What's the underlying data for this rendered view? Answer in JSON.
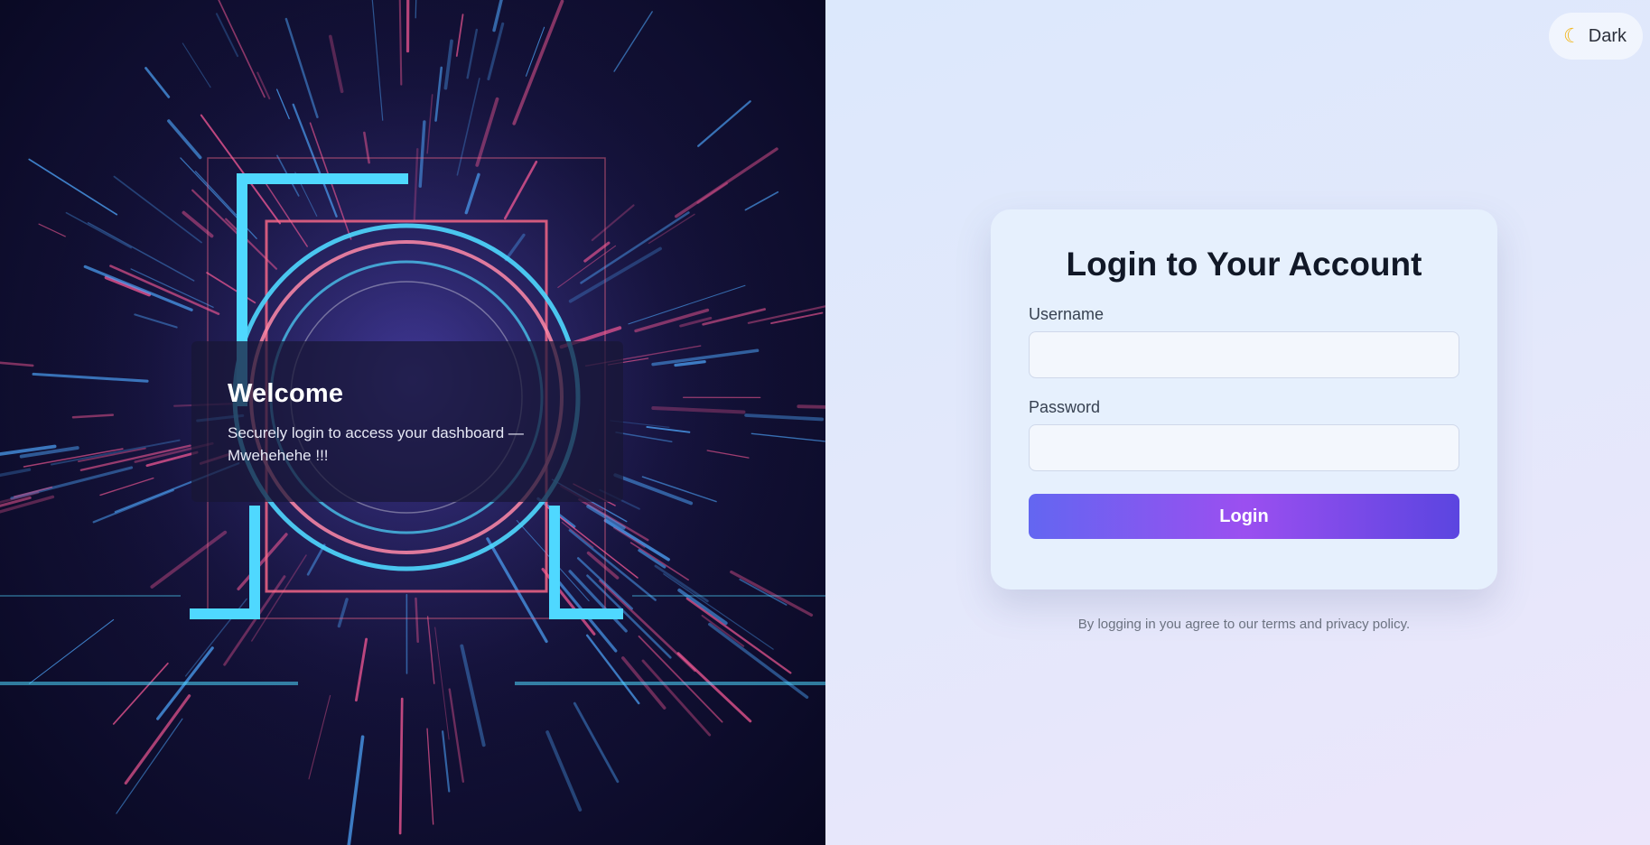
{
  "hero": {
    "welcome_title": "Welcome",
    "welcome_text": "Securely login to access your dashboard — Mwehehehe !!!"
  },
  "theme_toggle": {
    "icon": "moon-icon",
    "label": "Dark"
  },
  "login_form": {
    "title": "Login to Your Account",
    "username_label": "Username",
    "username_value": "",
    "password_label": "Password",
    "password_value": "",
    "submit_label": "Login"
  },
  "footer": {
    "terms_text": "By logging in you agree to our terms and privacy policy."
  },
  "colors": {
    "accent_start": "#6366f1",
    "accent_mid": "#9b4ff0",
    "accent_end": "#5b45e0",
    "hero_bg": "#14123a",
    "neon_cyan": "#4fd8ff",
    "neon_pink": "#ff6a8a"
  }
}
